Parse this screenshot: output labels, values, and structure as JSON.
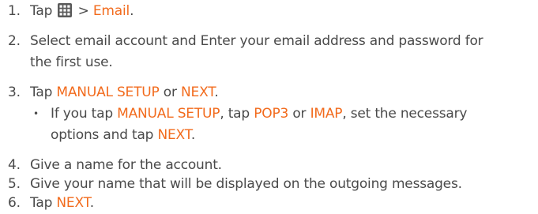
{
  "steps": [
    {
      "number": "1.",
      "pre": "Tap",
      "sep": ">",
      "email": "Email"
    },
    {
      "number": "2.",
      "line1": "Select email account and Enter your email address and password for",
      "line2": "the first use."
    },
    {
      "number": "3.",
      "pre": "Tap",
      "manual": "MANUAL SETUP",
      "or": "or",
      "next": "NEXT",
      "end": "."
    },
    {
      "bullet": "•",
      "if": "If you tap",
      "manual": "MANUAL SETUP",
      "tap": ", tap",
      "pop3": "POP3",
      "or": "or",
      "imap": "IMAP",
      "rest1": ", set the necessary",
      "rest2": "options and tap",
      "next": "NEXT",
      "end": "."
    },
    {
      "number": "4.",
      "text": "Give a name for the account."
    },
    {
      "number": "5.",
      "text": "Give your name that will be displayed on the outgoing messages."
    },
    {
      "number": "6.",
      "pre": "Tap",
      "next": "NEXT",
      "end": "."
    }
  ],
  "icons": {
    "apps": "apps-grid-icon"
  },
  "colors": {
    "text": "#4a4a4a",
    "highlight": "#f26b1d",
    "icon": "#5a5a5a"
  }
}
